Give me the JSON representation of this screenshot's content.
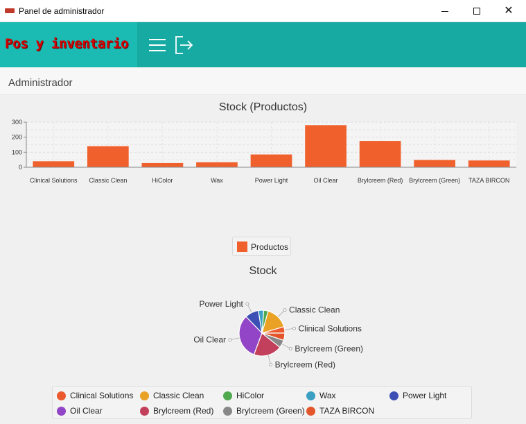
{
  "window": {
    "title": "Panel de administrador"
  },
  "header": {
    "brand": "Pos y inventario"
  },
  "subheader": {
    "title": "Administrador"
  },
  "colors": {
    "header": "#17aaa3",
    "brand_bg": "#1bbab2",
    "bar": "#f0602c",
    "brand_text": "#d40000"
  },
  "icons": {
    "menu": "hamburger-icon",
    "logout": "logout-icon"
  },
  "chart_data": [
    {
      "type": "bar",
      "title": "Stock (Productos)",
      "categories": [
        "Clinical Solutions",
        "Classic Clean",
        "HiColor",
        "Wax",
        "Power Light",
        "Oil Clear",
        "Brylcreem (Red)",
        "Brylcreem (Green)",
        "TAZA BIRCON"
      ],
      "series": [
        {
          "name": "Productos",
          "values": [
            40,
            140,
            28,
            33,
            85,
            280,
            175,
            48,
            45
          ]
        }
      ],
      "yticks": [
        0,
        100,
        200,
        300
      ],
      "ylim": [
        0,
        300
      ],
      "grid": true,
      "legend": "bottom"
    },
    {
      "type": "pie",
      "title": "Stock",
      "categories": [
        "Clinical Solutions",
        "Classic Clean",
        "HiColor",
        "Wax",
        "Power Light",
        "Oil Clear",
        "Brylcreem (Red)",
        "Brylcreem (Green)",
        "TAZA BIRCON"
      ],
      "values": [
        40,
        140,
        28,
        33,
        85,
        280,
        175,
        48,
        45
      ],
      "colors": [
        "#ea5a2e",
        "#e9a126",
        "#4fa94f",
        "#3a9fc0",
        "#3c4fb4",
        "#9245c6",
        "#c2405b",
        "#888888",
        "#e3562b"
      ],
      "labeled": [
        "Brylcreem (Red)",
        "Brylcreem (Green)",
        "Clinical Solutions",
        "Classic Clean",
        "Power Light",
        "Oil Clear"
      ],
      "legend": "bottom"
    }
  ]
}
